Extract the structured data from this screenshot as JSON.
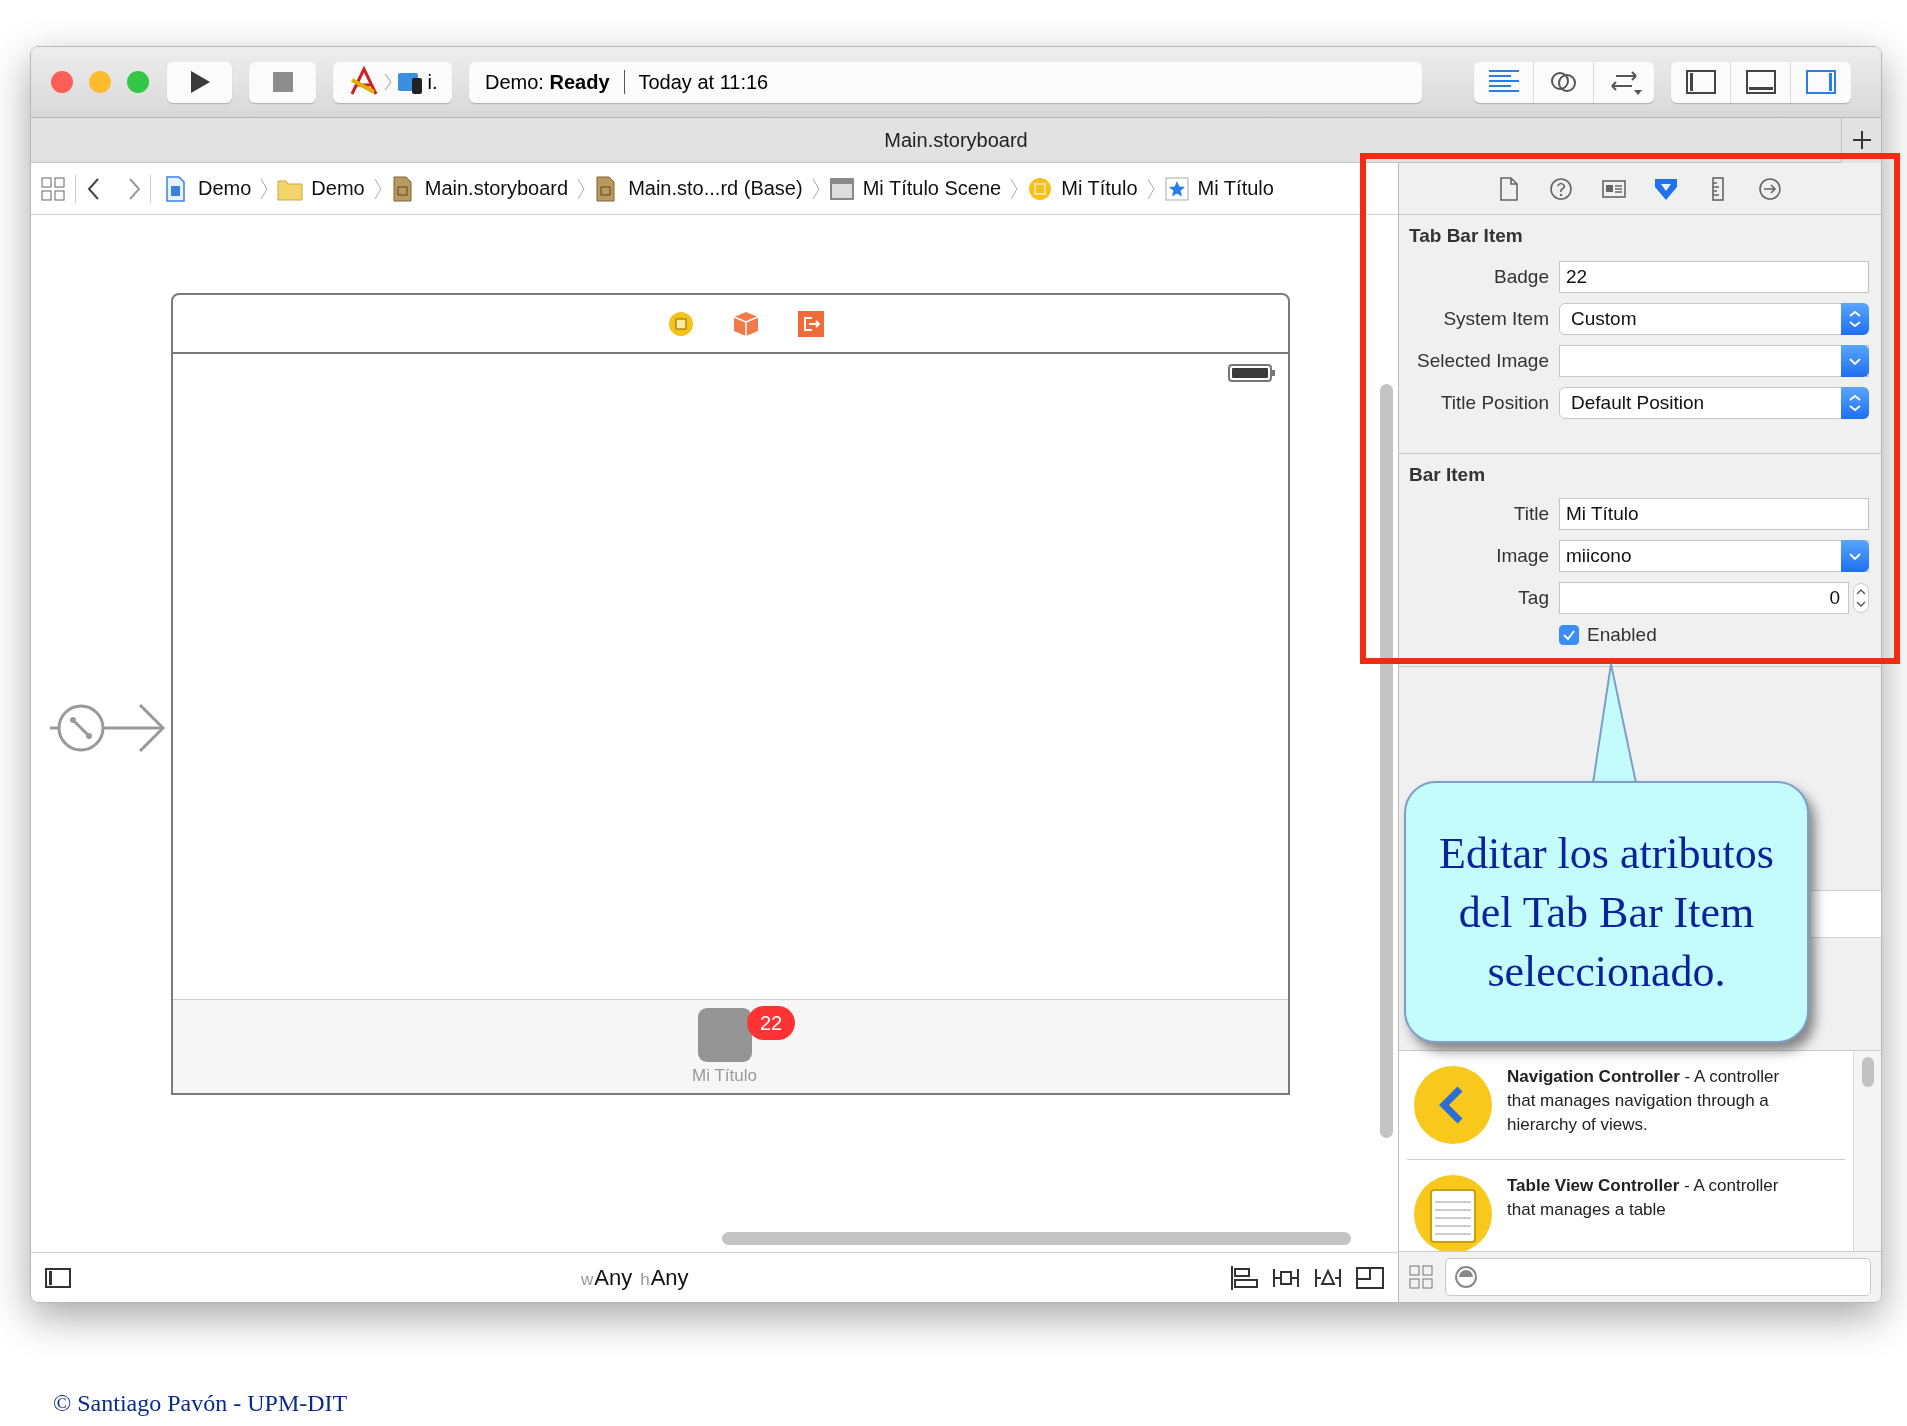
{
  "toolbar": {
    "scheme": {
      "target": "i."
    },
    "status": {
      "activity": "Demo: **Ready**",
      "time": "Today at 11:16"
    },
    "editor_modes": [
      {
        "kind": "standard",
        "selected": true
      },
      {
        "kind": "assistant",
        "selected": false
      },
      {
        "kind": "version",
        "selected": false
      }
    ],
    "panels": [
      {
        "kind": "navigator",
        "on": false
      },
      {
        "kind": "debug",
        "on": false
      },
      {
        "kind": "utilities",
        "on": true
      }
    ]
  },
  "tab_title": "Main.storyboard",
  "breadcrumbs": [
    {
      "kind": "project",
      "label": "Demo"
    },
    {
      "kind": "folder",
      "label": "Demo"
    },
    {
      "kind": "storyboard",
      "label": "Main.storyboard"
    },
    {
      "kind": "storyboard",
      "label": "Main.sto...rd (Base)"
    },
    {
      "kind": "scene",
      "label": "Mi Título Scene"
    },
    {
      "kind": "controller",
      "label": "Mi Título"
    },
    {
      "kind": "tabitem",
      "label": "Mi Título"
    }
  ],
  "canvas": {
    "tab_item": {
      "title": "Mi Título",
      "badge": "22"
    }
  },
  "size_class": [
    {
      "prefix": "w",
      "value": "Any"
    },
    {
      "prefix": "h",
      "value": "Any"
    }
  ],
  "inspector": {
    "tabs": [
      {
        "kind": "file",
        "selected": false
      },
      {
        "kind": "help",
        "selected": false
      },
      {
        "kind": "identity",
        "selected": false
      },
      {
        "kind": "attributes",
        "selected": true
      },
      {
        "kind": "size",
        "selected": false
      },
      {
        "kind": "connections",
        "selected": false
      }
    ],
    "sections": [
      {
        "title": "Tab Bar Item",
        "fields": [
          {
            "kind": "text",
            "label": "Badge",
            "value": "22"
          },
          {
            "kind": "popup",
            "label": "System Item",
            "value": "Custom"
          },
          {
            "kind": "combo",
            "label": "Selected Image"
          },
          {
            "kind": "popup",
            "label": "Title Position",
            "value": "Default Position"
          }
        ]
      },
      {
        "title": "Bar Item",
        "fields": [
          {
            "kind": "text",
            "label": "Title",
            "value": "Mi Título"
          },
          {
            "kind": "combo",
            "label": "Image",
            "value": "miicono"
          },
          {
            "kind": "stepper",
            "label": "Tag",
            "value": "0"
          },
          {
            "kind": "checkbox",
            "label": "Enabled",
            "checked": true
          }
        ]
      }
    ]
  },
  "library": {
    "items": [
      {
        "kind": "navigation",
        "text": "**Navigation Controller** - A controller that manages navigation through a hierarchy of views."
      },
      {
        "kind": "table",
        "text": "**Table View Controller** - A controller that manages a table"
      }
    ]
  },
  "callout": {
    "text": "Editar los atributos del Tab Bar Item seleccionado."
  },
  "footer": "© Santiago Pavón - UPM-DIT"
}
